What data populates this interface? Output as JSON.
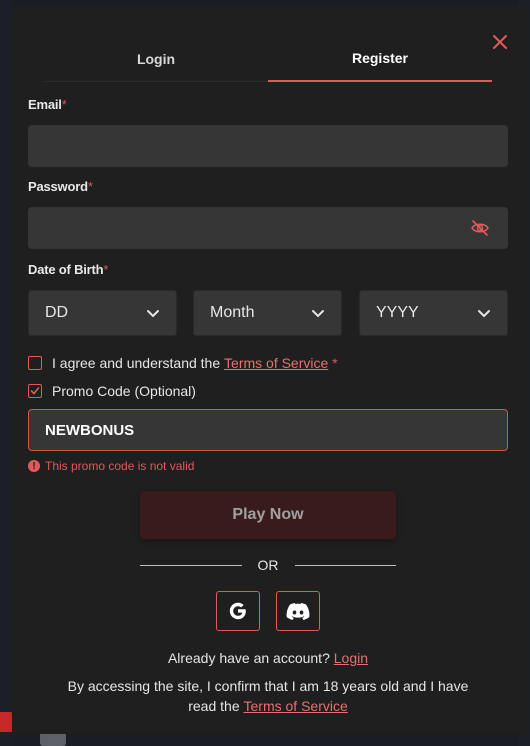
{
  "tabs": {
    "login": "Login",
    "register": "Register"
  },
  "form": {
    "email_label": "Email",
    "password_label": "Password",
    "dob_label": "Date of Birth",
    "required_mark": "*",
    "day_value": "DD",
    "month_value": "Month",
    "year_value": "YYYY",
    "terms_prefix": "I agree and understand the",
    "terms_link": "Terms of Service",
    "promo_label": "Promo Code (Optional)",
    "promo_value": "NEWBONUS",
    "promo_error": "This promo code is not valid",
    "submit_label": "Play Now"
  },
  "divider_text": "OR",
  "footer": {
    "have_account": "Already have an account?",
    "login_link": "Login",
    "disclaimer": "By accessing the site, I confirm that I am 18 years old and I have read the",
    "terms_link": "Terms of Service"
  },
  "colors": {
    "accent": "#e05a5a",
    "modal_bg": "#1f1f1f",
    "input_bg": "#363636"
  },
  "icons": [
    "close-icon",
    "eye-off-icon",
    "chevron-down-icon",
    "check-icon",
    "alert-icon",
    "google-icon",
    "discord-icon"
  ]
}
